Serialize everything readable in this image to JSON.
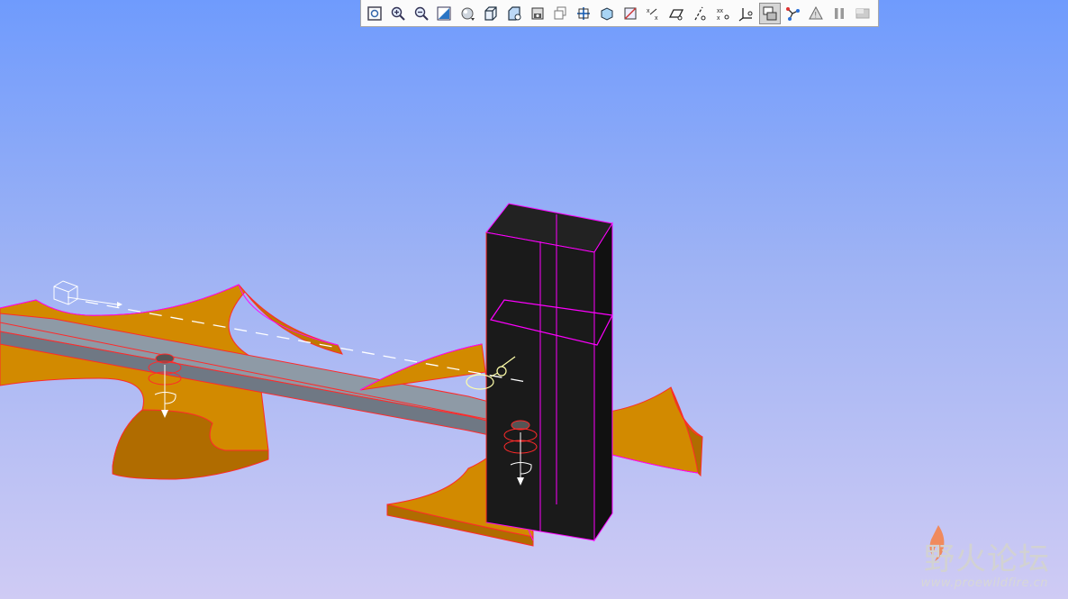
{
  "toolbar": {
    "buttons": [
      {
        "name": "refit-icon"
      },
      {
        "name": "zoom-in-icon"
      },
      {
        "name": "zoom-out-icon"
      },
      {
        "name": "repaint-icon"
      },
      {
        "name": "orient-icon"
      },
      {
        "name": "saved-views-icon"
      },
      {
        "name": "view-manager-icon"
      },
      {
        "name": "display-style-icon"
      },
      {
        "name": "layers-icon"
      },
      {
        "name": "spin-center-icon"
      },
      {
        "name": "perspective-icon"
      },
      {
        "name": "annotation-display-icon"
      },
      {
        "name": "datum-points-icon"
      },
      {
        "name": "datum-planes-icon"
      },
      {
        "name": "datum-axes-icon"
      },
      {
        "name": "point-tags-icon"
      },
      {
        "name": "coordinate-systems-icon"
      },
      {
        "name": "display-mode-icon"
      },
      {
        "name": "connections-icon"
      },
      {
        "name": "warning-icon"
      },
      {
        "name": "pause-icon"
      },
      {
        "name": "disabled-tool-icon"
      }
    ],
    "active_index": 17
  },
  "watermark": {
    "title": "野火论坛",
    "url": "www.proewildfire.cn"
  },
  "colors": {
    "part_fill": "#d48a00",
    "edge_highlight": "#ff00ff",
    "edge_red": "#ff1a1a",
    "block": "#1a1a1a",
    "bar": "#8e9aa6"
  }
}
